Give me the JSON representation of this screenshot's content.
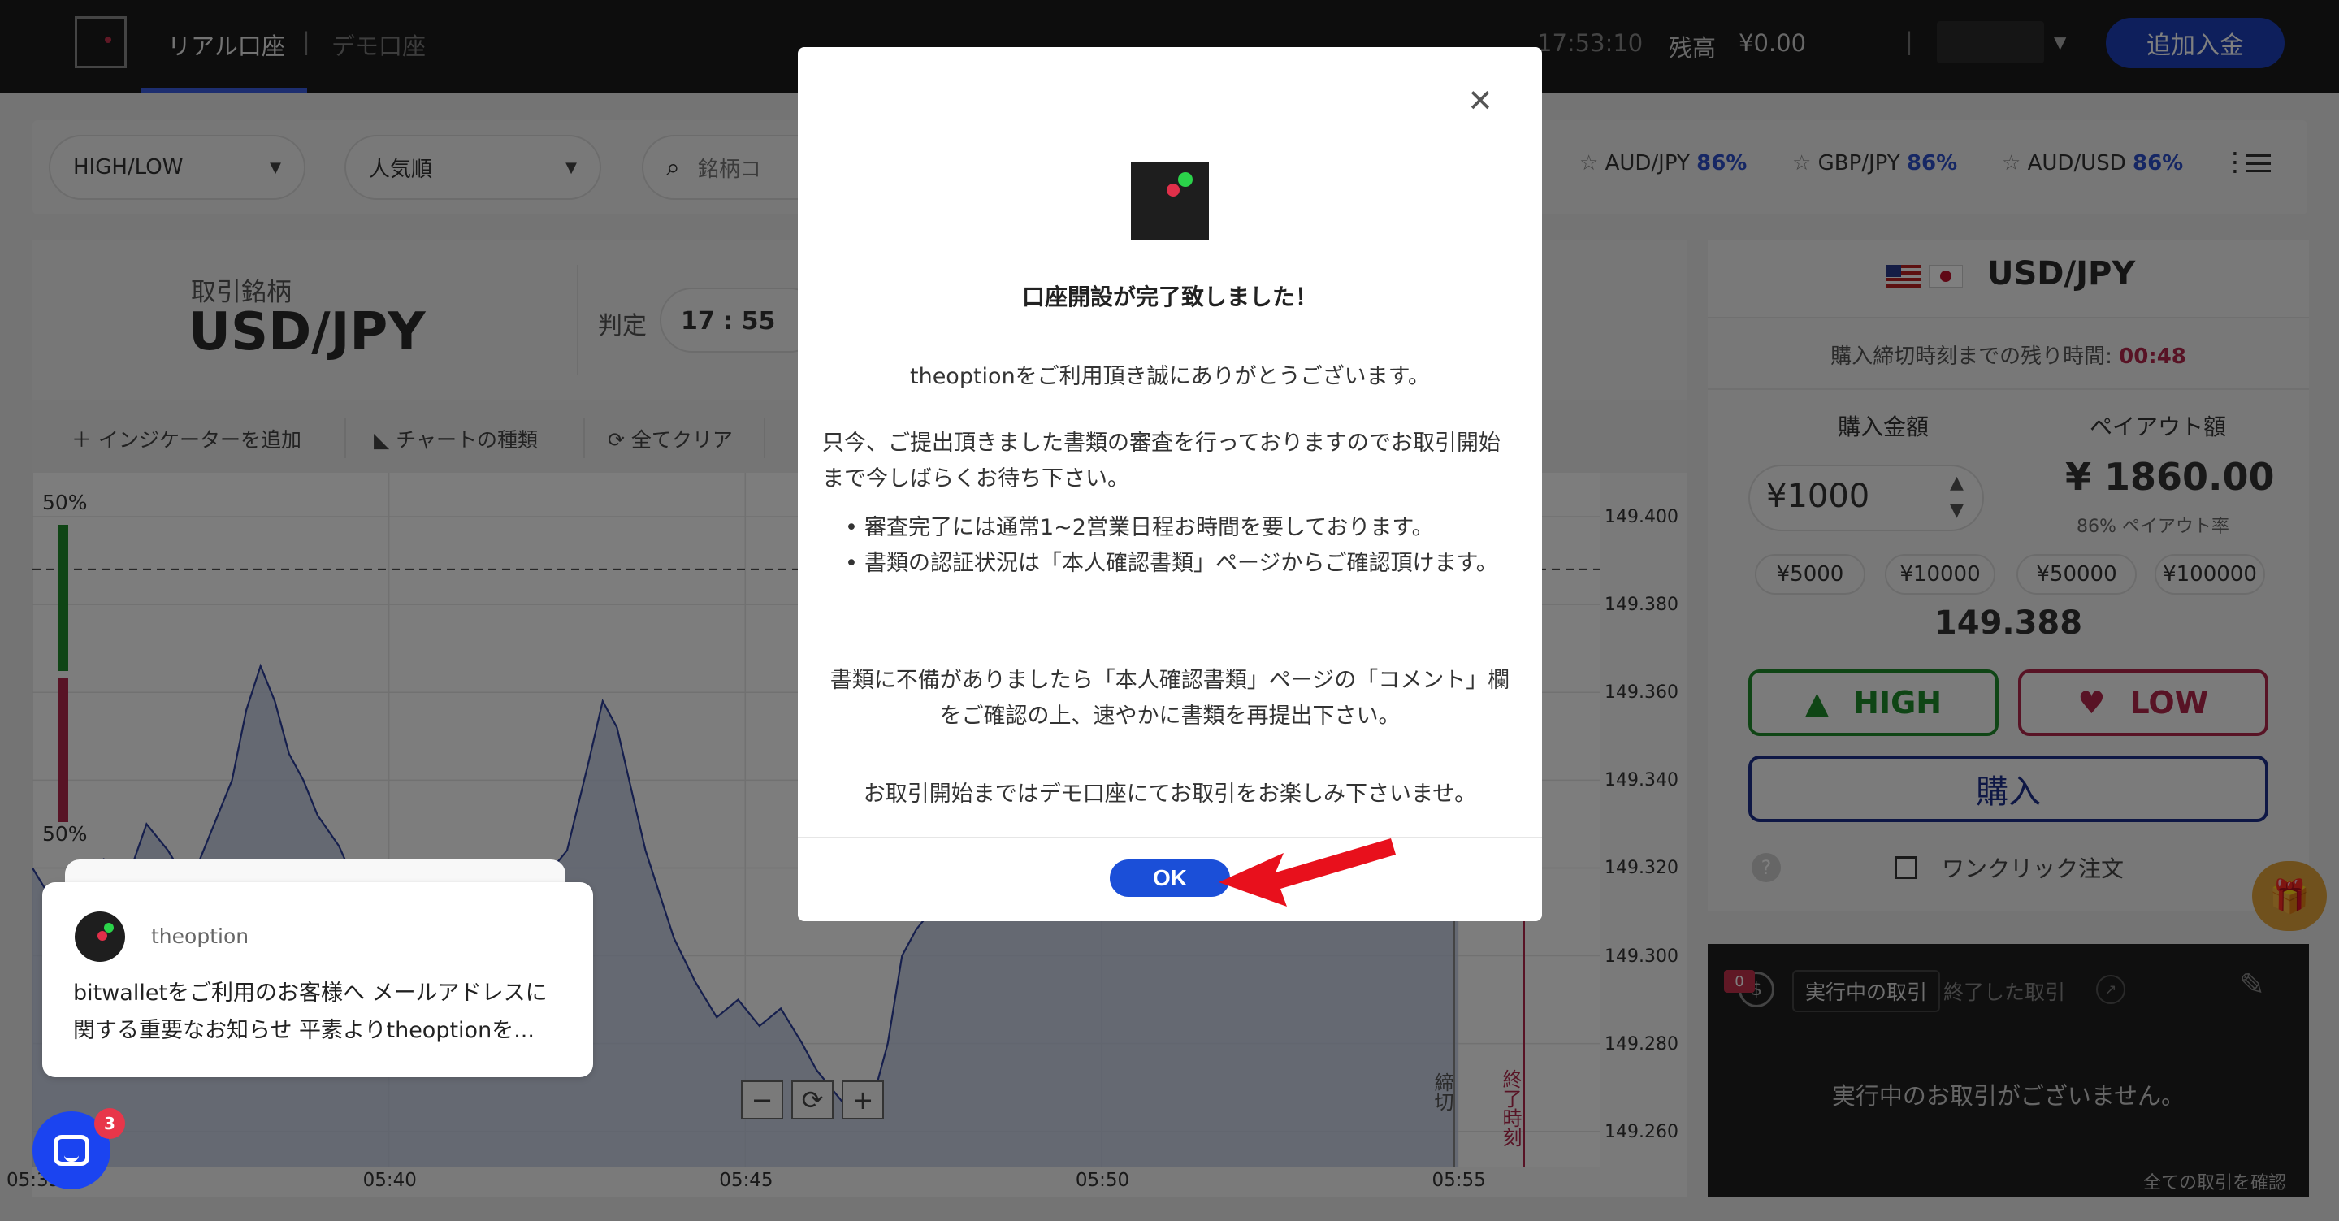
{
  "topbar": {
    "tab_real": "リアル口座",
    "tab_sep": "|",
    "tab_demo": "デモ口座",
    "time": "17:53:10",
    "balance_label": "残高",
    "balance": "¥0.00",
    "user_sep": "|",
    "username": "",
    "deposit": "追加入金"
  },
  "filters": {
    "type": "HIGH/LOW",
    "sort": "人気順",
    "search_placeholder": "銘柄コ",
    "favorites": [
      {
        "pair": "AUD/JPY",
        "rate": "86%"
      },
      {
        "pair": "GBP/JPY",
        "rate": "86%"
      },
      {
        "pair": "AUD/USD",
        "rate": "86%"
      }
    ]
  },
  "instrument": {
    "label": "取引銘柄",
    "symbol": "USD/JPY",
    "judge_label": "判定",
    "judge_time": "17 : 55"
  },
  "toolbar": {
    "add_indicator": "インジケーターを追加",
    "chart_type": "チャートの種類",
    "clear_all": "全てクリア"
  },
  "chart": {
    "sentiment_high": "50%",
    "sentiment_low": "50%",
    "deadline_label": "締切",
    "end_label": "終了時刻"
  },
  "chart_data": {
    "type": "area",
    "x_ticks": [
      "05:35",
      "05:40",
      "05:45",
      "05:50",
      "05:55"
    ],
    "y_ticks": [
      149.4,
      149.38,
      149.36,
      149.34,
      149.32,
      149.3,
      149.28,
      149.26
    ],
    "ylim": [
      149.252,
      149.41
    ],
    "xlim": [
      0,
      22.0
    ],
    "reference_price": 149.388,
    "series": [
      {
        "x": [
          0,
          0.3,
          0.6,
          1.0,
          1.3,
          1.6,
          1.9,
          2.2,
          2.5,
          2.8,
          3.0,
          3.2,
          3.4,
          3.6,
          3.8,
          4.0,
          4.3,
          4.6,
          4.9,
          5.2,
          5.5,
          5.8,
          6.0,
          6.3,
          6.6,
          6.9,
          7.2,
          7.5,
          7.8,
          8.0,
          8.2,
          8.4,
          8.6,
          8.8,
          9.0,
          9.3,
          9.6,
          9.9,
          10.2,
          10.5,
          10.8,
          11.0,
          11.2,
          11.4,
          11.6,
          11.8,
          12.0,
          12.2,
          12.4,
          12.7,
          13.0,
          13.5,
          14.0,
          14.5,
          15.0,
          15.5,
          16.0,
          16.5,
          17.0,
          17.5,
          18.0,
          18.5,
          19.0,
          19.5,
          20.0
        ],
        "y": [
          149.32,
          149.312,
          149.318,
          149.322,
          149.316,
          149.33,
          149.324,
          149.316,
          149.328,
          149.34,
          149.356,
          149.366,
          149.358,
          149.346,
          149.34,
          149.332,
          149.325,
          149.314,
          149.306,
          149.3,
          149.31,
          149.304,
          149.298,
          149.305,
          149.3,
          149.308,
          149.318,
          149.324,
          149.344,
          149.358,
          149.352,
          149.338,
          149.324,
          149.314,
          149.304,
          149.294,
          149.286,
          149.29,
          149.284,
          149.288,
          149.28,
          149.274,
          149.27,
          149.266,
          149.27,
          149.268,
          149.28,
          149.3,
          149.306,
          149.312,
          149.318,
          149.324,
          149.33,
          149.336,
          149.33,
          149.338,
          149.332,
          149.34,
          149.336,
          149.342,
          149.338,
          149.344,
          149.34,
          149.346,
          149.342
        ]
      }
    ],
    "grid": true
  },
  "order": {
    "symbol": "USD/JPY",
    "remaining_label": "購入締切時刻までの残り時間:",
    "remaining": "00:48",
    "amount_label": "購入金額",
    "payout_label": "ペイアウト額",
    "amount": "¥1000",
    "payout": "¥ 1860.00",
    "payout_rate": "86% ペイアウト率",
    "chips": [
      "¥5000",
      "¥10000",
      "¥50000",
      "¥100000"
    ],
    "price": "149.388",
    "high": "HIGH",
    "low": "LOW",
    "buy": "購入",
    "one_click": "ワンクリック注文"
  },
  "trades": {
    "badge": "0",
    "tab_active": "実行中の取引",
    "tab_closed": "終了した取引",
    "empty": "実行中のお取引がございません。",
    "view_all": "全ての取引を確認"
  },
  "modal": {
    "title": "口座開設が完了致しました！",
    "p1": "theoptionをご利用頂き誠にありがとうございます。",
    "p2": "只今、ご提出頂きました書類の審査を行っておりますのでお取引開始まで今しばらくお待ち下さい。",
    "li1": "審査完了には通常1~2営業日程お時間を要しております。",
    "li2": "書類の認証状況は「本人確認書類」ページからご確認頂けます。",
    "p3": "書類に不備がありましたら「本人確認書類」ページの「コメント」欄をご確認の上、速やかに書類を再提出下さい。",
    "p4": "お取引開始まではデモ口座にてお取引をお楽しみ下さいませ。",
    "ok": "OK"
  },
  "notification": {
    "from": "theoption",
    "text": "bitwalletをご利用のお客様へ メールアドレスに関する重要なお知らせ 平素よりtheoptionを..."
  },
  "chat": {
    "badge": "3"
  },
  "colors": {
    "accent": "#1b4fd8",
    "high": "#1f8a2a",
    "low": "#b0274a",
    "arrow": "#e8101c"
  }
}
